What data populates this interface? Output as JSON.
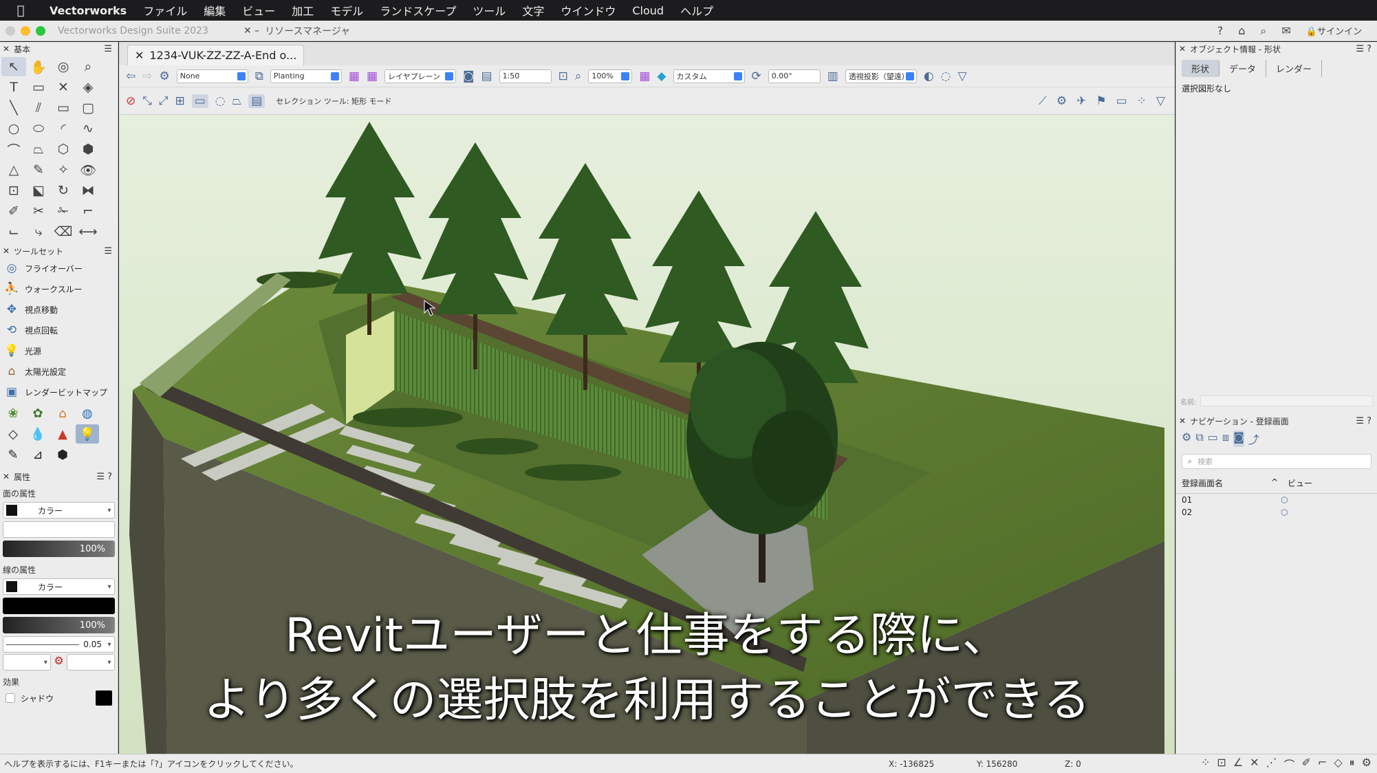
{
  "menubar": {
    "apple": "",
    "app": "Vectorworks",
    "items": [
      "ファイル",
      "編集",
      "ビュー",
      "加工",
      "モデル",
      "ランドスケープ",
      "ツール",
      "文字",
      "ウインドウ",
      "Cloud",
      "ヘルプ"
    ]
  },
  "window": {
    "title": "Vectorworks Design Suite 2023",
    "resource_manager": "リソースマネージャ",
    "signin": "サインイン",
    "help_glyph": "?"
  },
  "basic_palette": {
    "title": "基本"
  },
  "toolsets": {
    "title": "ツールセット",
    "items": [
      "フライオーバー",
      "ウォークスルー",
      "視点移動",
      "視点回転",
      "光源",
      "太陽光設定",
      "レンダービットマップ"
    ]
  },
  "attributes": {
    "title": "属性",
    "fill_label": "面の属性",
    "fill_type": "カラー",
    "fill_opacity": "100%",
    "line_label": "線の属性",
    "line_type": "カラー",
    "line_opacity": "100%",
    "line_weight": "0.05",
    "effects_label": "効果",
    "shadow_label": "シャドウ"
  },
  "document": {
    "tab_label": "1234-VUK-ZZ-ZZ-A-End o..."
  },
  "view_bar": {
    "class_popup": "None",
    "layer_popup": "Planting",
    "plane_popup": "レイヤプレーン",
    "scale": "1:50",
    "zoom": "100%",
    "view_popup": "カスタム",
    "rotation": "0.00°",
    "projection_popup": "透視投影（望遠）"
  },
  "mode_bar": {
    "hint": "セレクション ツール: 矩形 モード"
  },
  "obj_info": {
    "title": "オブジェクト情報 - 形状",
    "tabs": [
      "形状",
      "データ",
      "レンダー"
    ],
    "no_selection": "選択図形なし",
    "name_label": "名前:"
  },
  "navigation": {
    "title": "ナビゲーション - 登録画面",
    "search_placeholder": "検索",
    "col_name": "登録画面名",
    "col_view": "ビュー",
    "rows": [
      "01",
      "02"
    ]
  },
  "subtitle": {
    "line1": "Revitユーザーと仕事をする際に、",
    "line2": "より多くの選択肢を利用することができる"
  },
  "status": {
    "help": "ヘルプを表示するには、F1キーまたは「?」アイコンをクリックしてください。",
    "x": "X: -136825",
    "y": "Y: 156280",
    "z": "Z: 0"
  },
  "colors": {
    "grass": "#5f7a32",
    "sky": "#dce8cf",
    "wall": "#4f4a3c",
    "soil": "#5a4a3a"
  }
}
